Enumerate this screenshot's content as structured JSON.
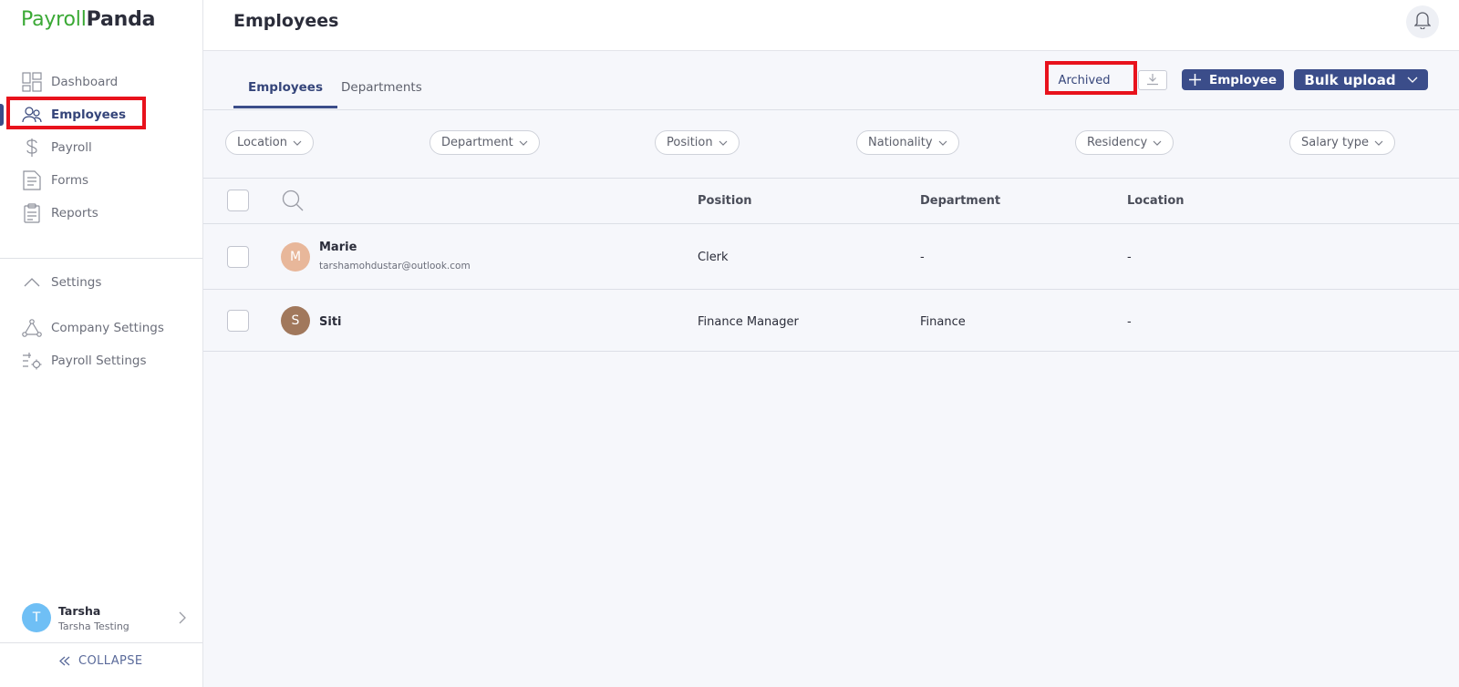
{
  "brand": {
    "part1": "Payroll",
    "part2": "Panda"
  },
  "sidebar": {
    "items": [
      {
        "label": "Dashboard",
        "icon": "dashboard-icon"
      },
      {
        "label": "Employees",
        "icon": "people-icon"
      },
      {
        "label": "Payroll",
        "icon": "dollar-icon"
      },
      {
        "label": "Forms",
        "icon": "document-icon"
      },
      {
        "label": "Reports",
        "icon": "clipboard-icon"
      }
    ],
    "settings_label": "Settings",
    "settings_items": [
      {
        "label": "Company Settings",
        "icon": "network-icon"
      },
      {
        "label": "Payroll Settings",
        "icon": "dollar-gear-icon"
      }
    ],
    "user": {
      "initial": "T",
      "name": "Tarsha",
      "org": "Tarsha Testing"
    },
    "collapse_label": "COLLAPSE"
  },
  "header": {
    "title": "Employees"
  },
  "tabs": [
    {
      "label": "Employees",
      "active": true
    },
    {
      "label": "Departments",
      "active": false
    }
  ],
  "actions": {
    "archived": "Archived",
    "add_employee": "Employee",
    "bulk_upload": "Bulk upload"
  },
  "filters": [
    "Location",
    "Department",
    "Position",
    "Nationality",
    "Residency",
    "Salary type"
  ],
  "table": {
    "columns": [
      "Position",
      "Department",
      "Location"
    ],
    "rows": [
      {
        "initial": "M",
        "name": "Marie",
        "email": "tarshamohdustar@outlook.com",
        "position": "Clerk",
        "department": "-",
        "location": "-",
        "avatar_color": "#e8b79a"
      },
      {
        "initial": "S",
        "name": "Siti",
        "email": "",
        "position": "Finance Manager",
        "department": "Finance",
        "location": "-",
        "avatar_color": "#a1785c"
      }
    ]
  },
  "colors": {
    "primary": "#3b4d8a",
    "brand_green": "#3aa935",
    "highlight": "#e8121c"
  }
}
